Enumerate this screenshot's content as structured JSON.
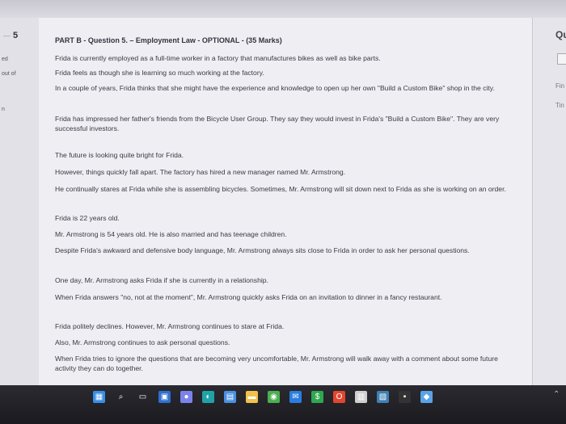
{
  "left_panel": {
    "question_prev": "5",
    "label_1": "ed",
    "label_2": "out of",
    "label_3": "n"
  },
  "right_panel": {
    "label_qu": "Qu",
    "label_fin": "Fin",
    "label_tim": "Tin"
  },
  "question": {
    "title": "PART B - Question 5. – Employment Law - OPTIONAL - (35 Marks)",
    "paragraphs": [
      "Frida is currently employed as a full-time worker in a factory that manufactures bikes as well as bike parts.",
      "Frida feels as though she is learning so much working at the factory.",
      "In a couple of years, Frida thinks that she might have the experience and knowledge to open up her own \"Build a Custom Bike\" shop in the city.",
      "Frida has impressed her father's friends from the Bicycle User Group. They say they would invest in Frida's \"Build a Custom Bike\". They are very successful investors.",
      "The future is looking quite bright for Frida.",
      "However, things quickly fall apart. The factory has hired a new manager named Mr. Armstrong.",
      "He continually stares at Frida while she is assembling bicycles. Sometimes, Mr. Armstrong will sit down next to Frida as she is working on an order.",
      "Frida is 22 years old.",
      "Mr. Armstrong is 54 years old. He is also married and has teenage children.",
      "Despite Frida's awkward and defensive body language, Mr. Armstrong always sits close to Frida in order to ask her personal questions.",
      "One day, Mr. Armstrong asks Frida if she is currently in a relationship.",
      "When Frida answers \"no, not at the moment\", Mr. Armstrong quickly asks Frida on an invitation to dinner in a fancy restaurant.",
      "Frida politely declines. However, Mr. Armstrong continues to stare at Frida.",
      "Also, Mr. Armstrong continues to ask personal questions.",
      "When Frida tries to ignore the questions that are becoming very uncomfortable, Mr. Armstrong will walk away with a comment about some future activity they can do together."
    ]
  },
  "taskbar": {
    "icons": [
      {
        "name": "windows-start-icon",
        "color": "#3a8ee6"
      },
      {
        "name": "search-icon",
        "color": "#ffffff"
      },
      {
        "name": "task-view-icon",
        "color": "#ffffff"
      },
      {
        "name": "widgets-icon",
        "color": "#2e6fd0"
      },
      {
        "name": "chat-icon",
        "color": "#7b83eb"
      },
      {
        "name": "edge-icon",
        "color": "#1fa3a8"
      },
      {
        "name": "store-icon",
        "color": "#4a8fe0"
      },
      {
        "name": "file-explorer-icon",
        "color": "#f2c14b"
      },
      {
        "name": "chrome-icon",
        "color": "#4caf50"
      },
      {
        "name": "mail-icon",
        "color": "#2a7de1"
      },
      {
        "name": "money-app-icon",
        "color": "#2fa84f"
      },
      {
        "name": "office-icon",
        "color": "#e2462f"
      },
      {
        "name": "calculator-icon",
        "color": "#cfcfcf"
      },
      {
        "name": "gallery-icon",
        "color": "#3f7fb5"
      },
      {
        "name": "terminal-icon",
        "color": "#333333"
      },
      {
        "name": "weather-icon",
        "color": "#5aa3e8"
      }
    ]
  }
}
